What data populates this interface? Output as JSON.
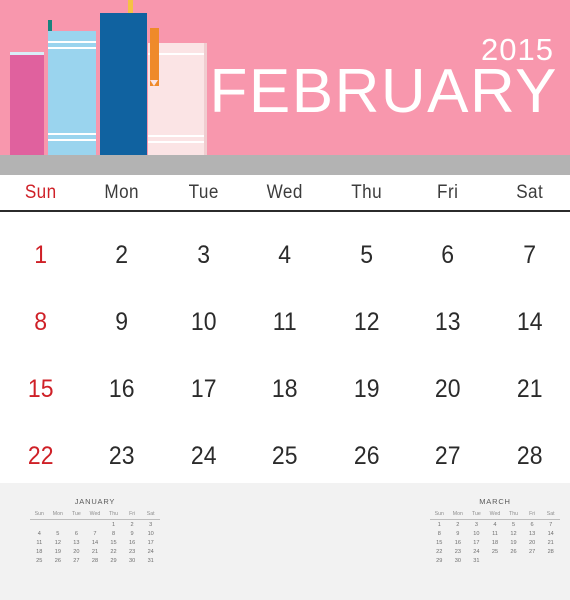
{
  "header": {
    "year": "2015",
    "month_name": "FEBRUARY",
    "bg_color": "#F897AD",
    "shelf_color": "#B3B3B3",
    "illustration": "stack-of-books"
  },
  "weekdays": [
    {
      "label": "Sun",
      "weekend": true
    },
    {
      "label": "Mon",
      "weekend": false
    },
    {
      "label": "Tue",
      "weekend": false
    },
    {
      "label": "Wed",
      "weekend": false
    },
    {
      "label": "Thu",
      "weekend": false
    },
    {
      "label": "Fri",
      "weekend": false
    },
    {
      "label": "Sat",
      "weekend": false
    }
  ],
  "colors": {
    "sunday_red": "#CF2027",
    "day_text": "#2B2B2B",
    "footer_bg": "#F2F2F2",
    "book_pink": "#E0619E",
    "book_light_blue": "#9AD4EE",
    "book_dark_blue": "#1062A0",
    "book_pale_pink": "#FBE4E5",
    "ribbon_orange": "#EF8A2A"
  },
  "grid": {
    "rows": [
      [
        "1",
        "2",
        "3",
        "4",
        "5",
        "6",
        "7"
      ],
      [
        "8",
        "9",
        "10",
        "11",
        "12",
        "13",
        "14"
      ],
      [
        "15",
        "16",
        "17",
        "18",
        "19",
        "20",
        "21"
      ],
      [
        "22",
        "23",
        "24",
        "25",
        "26",
        "27",
        "28"
      ]
    ]
  },
  "mini_calendars": [
    {
      "title": "JANUARY",
      "weekdays": [
        "Sun",
        "Mon",
        "Tue",
        "Wed",
        "Thu",
        "Fri",
        "Sat"
      ],
      "weeks": [
        [
          "",
          "",
          "",
          "",
          "1",
          "2",
          "3"
        ],
        [
          "4",
          "5",
          "6",
          "7",
          "8",
          "9",
          "10"
        ],
        [
          "11",
          "12",
          "13",
          "14",
          "15",
          "16",
          "17"
        ],
        [
          "18",
          "19",
          "20",
          "21",
          "22",
          "23",
          "24"
        ],
        [
          "25",
          "26",
          "27",
          "28",
          "29",
          "30",
          "31"
        ]
      ]
    },
    {
      "title": "MARCH",
      "weekdays": [
        "Sun",
        "Mon",
        "Tue",
        "Wed",
        "Thu",
        "Fri",
        "Sat"
      ],
      "weeks": [
        [
          "1",
          "2",
          "3",
          "4",
          "5",
          "6",
          "7"
        ],
        [
          "8",
          "9",
          "10",
          "11",
          "12",
          "13",
          "14"
        ],
        [
          "15",
          "16",
          "17",
          "18",
          "19",
          "20",
          "21"
        ],
        [
          "22",
          "23",
          "24",
          "25",
          "26",
          "27",
          "28"
        ],
        [
          "29",
          "30",
          "31",
          "",
          "",
          "",
          ""
        ]
      ]
    }
  ]
}
